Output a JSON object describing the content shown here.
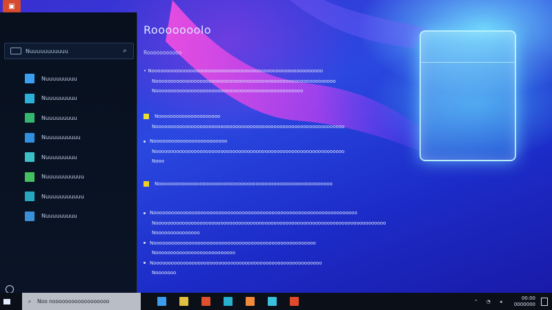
{
  "window": {
    "app_logo": "▣"
  },
  "start_panel": {
    "search": {
      "value": "Nuuuuuuuuuuu",
      "icon": "search-icon"
    },
    "apps": [
      {
        "label": "Nuuuuuuuuu",
        "color": "#3aa0f0"
      },
      {
        "label": "Nuuuuuuuuu",
        "color": "#2bb0d8"
      },
      {
        "label": "Nuuuuuuuuu",
        "color": "#34b870"
      },
      {
        "label": "Nuuuuuuuuuu",
        "color": "#2f8fe0"
      },
      {
        "label": "Nuuuuuuuuu",
        "color": "#3cc0c8"
      },
      {
        "label": "Nuuuuuuuuuuu",
        "color": "#44c060"
      },
      {
        "label": "Nuuuuuuuuuuu",
        "color": "#28a8c0"
      },
      {
        "label": "Nuuuuuuuuu",
        "color": "#3a90d8"
      }
    ],
    "settings_icon": "gear-icon"
  },
  "main": {
    "title": "Rooooooolo",
    "subtitle": "Rooooooooooo",
    "section1": {
      "lines": [
        "• Noooooooooooooooooooooooooooooooooooooooooooooooooooooooooo",
        "Nooooooooooooooooooooooooooooooooooooooooooooooooooooooooooooo",
        "Noooooooooooooooooooooooooooooooooooooooooooooooooo"
      ]
    },
    "section2": {
      "heading": "Nooooooooooooooooooooo",
      "line": "Noooooooooooooooooooooooooooooooooooooooooooooooooooooooooooooooo"
    },
    "section3": {
      "heading": "Nooooooooooooooooooooooooo",
      "lines": [
        "Noooooooooooooooooooooooooooooooooooooooooooooooooooooooooooooooo",
        "Nooo"
      ]
    },
    "section4": {
      "heading": "Nooooooooooooooooooooooooooooooooooooooooooooooooooooooooooo"
    },
    "section5": {
      "lines": [
        "Nooooooooooooooooooooooooooooooooooooooooooooooooooooooooooooooooooooo",
        "Noooooooooooooooooooooooooooooooooooooooooooooooooooooooooooooooooooooooooooooo",
        "Nooooooooooooooo",
        "Nooooooooooooooooooooooooooooooooooooooooooooooooooooooo",
        "Nooooooooooooooooooooooooooo",
        "Nooooooooooooooooooooooooooooooooooooooooooooooooooooooooo",
        "Nooooooo"
      ]
    }
  },
  "taskbar": {
    "search_value": "Noo noooooooooooooooooo",
    "pins": [
      "#3b9cf0",
      "#e0c040",
      "#e0502c",
      "#28b0d0",
      "#f08a3c",
      "#3cc0e0",
      "#e04a2a"
    ],
    "pin_icons": [
      "app-icon",
      "app-icon",
      "folder-icon",
      "app-icon",
      "app-icon",
      "app-icon",
      "app-icon"
    ],
    "clock_time": "00:00",
    "clock_date": "0000000"
  }
}
